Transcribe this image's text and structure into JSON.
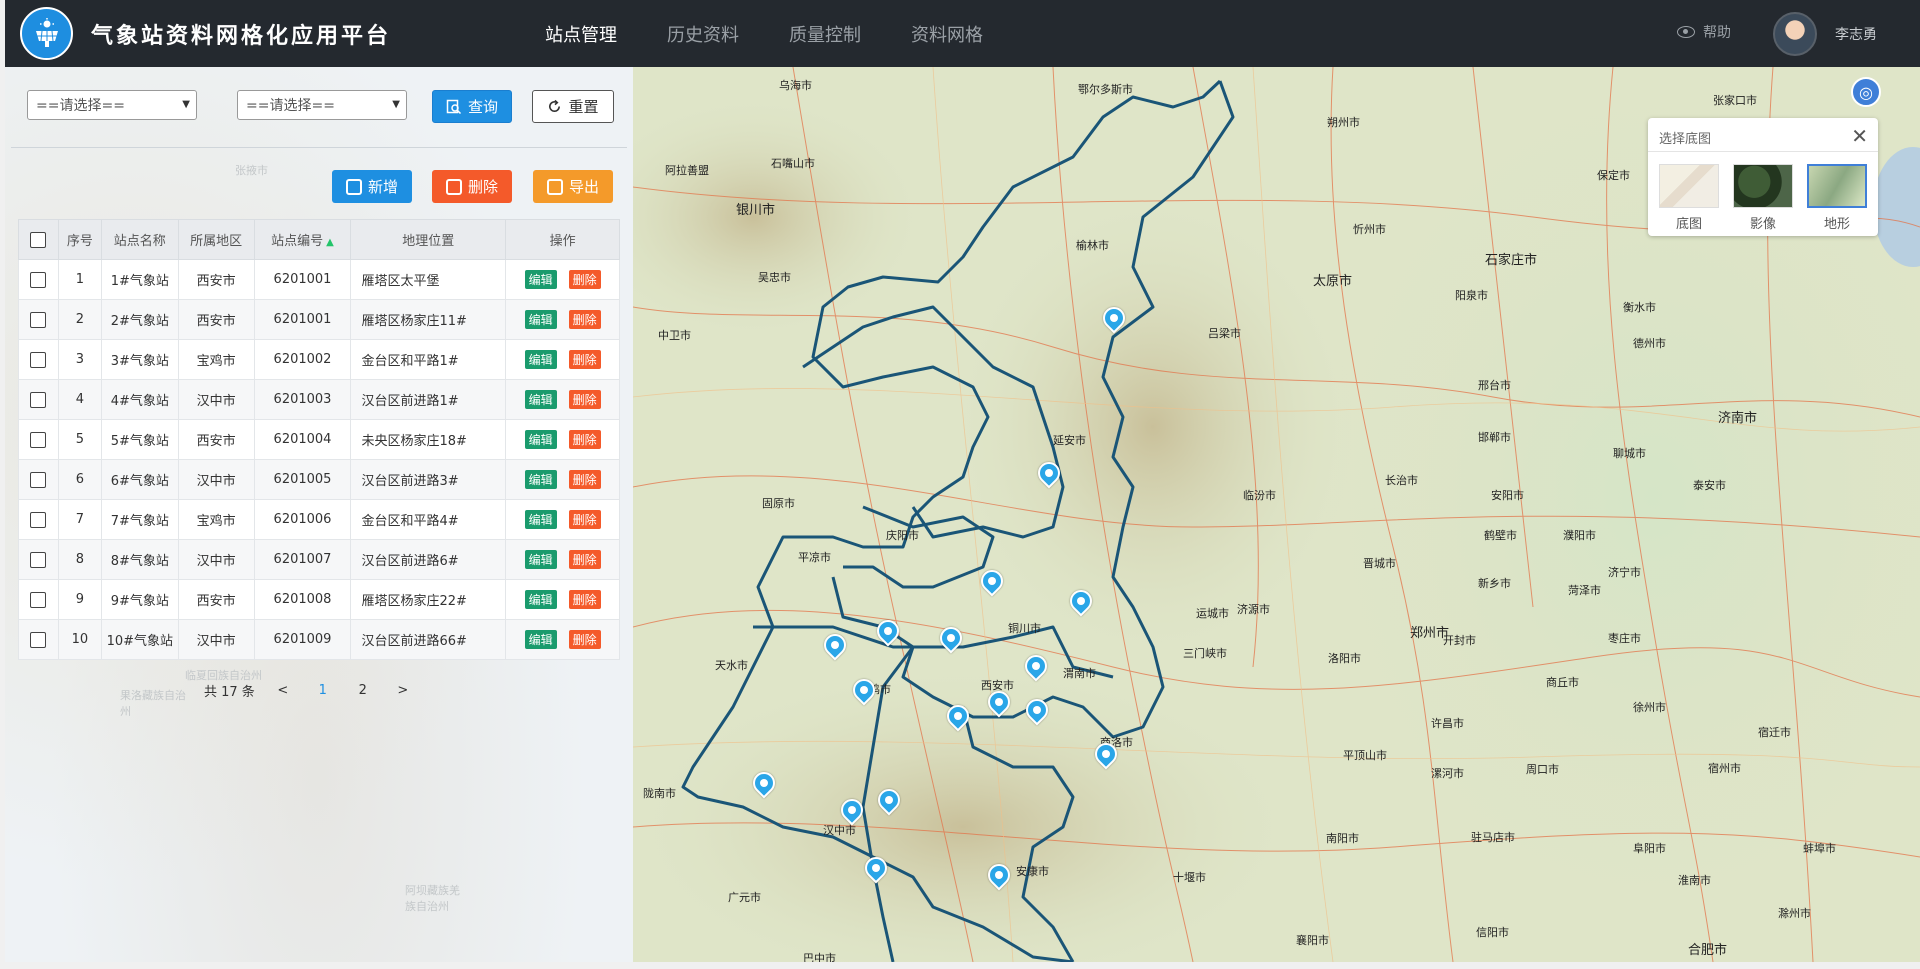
{
  "header": {
    "title": "气象站资料网格化应用平台",
    "nav": [
      "站点管理",
      "历史资料",
      "质量控制",
      "资料网格"
    ],
    "help": "帮助",
    "username": "李志勇"
  },
  "filters": {
    "select1": "==请选择==",
    "select2": "==请选择==",
    "query": "查询",
    "reset": "重置"
  },
  "actions": {
    "add": "新增",
    "delete": "删除",
    "export": "导出"
  },
  "table": {
    "headers": [
      "序号",
      "站点名称",
      "所属地区",
      "站点编号",
      "地理位置",
      "操作"
    ],
    "edit_label": "编辑",
    "delete_label": "删除",
    "rows": [
      {
        "no": "1",
        "name": "1#气象站",
        "region": "西安市",
        "code": "6201001",
        "location": "雁塔区太平堡"
      },
      {
        "no": "2",
        "name": "2#气象站",
        "region": "西安市",
        "code": "6201001",
        "location": "雁塔区杨家庄11#"
      },
      {
        "no": "3",
        "name": "3#气象站",
        "region": "宝鸡市",
        "code": "6201002",
        "location": "金台区和平路1#"
      },
      {
        "no": "4",
        "name": "4#气象站",
        "region": "汉中市",
        "code": "6201003",
        "location": "汉台区前进路1#"
      },
      {
        "no": "5",
        "name": "5#气象站",
        "region": "西安市",
        "code": "6201004",
        "location": "未央区杨家庄18#"
      },
      {
        "no": "6",
        "name": "6#气象站",
        "region": "汉中市",
        "code": "6201005",
        "location": "汉台区前进路3#"
      },
      {
        "no": "7",
        "name": "7#气象站",
        "region": "宝鸡市",
        "code": "6201006",
        "location": "金台区和平路4#"
      },
      {
        "no": "8",
        "name": "8#气象站",
        "region": "汉中市",
        "code": "6201007",
        "location": "汉台区前进路6#"
      },
      {
        "no": "9",
        "name": "9#气象站",
        "region": "西安市",
        "code": "6201008",
        "location": "雁塔区杨家庄22#"
      },
      {
        "no": "10",
        "name": "10#气象站",
        "region": "汉中市",
        "code": "6201009",
        "location": "汉台区前进路66#"
      }
    ]
  },
  "pager": {
    "total": "共 17 条",
    "prev": "<",
    "pages": [
      "1",
      "2"
    ],
    "next": ">"
  },
  "left_bg_labels": [
    "张掖市",
    "临夏回族自治州",
    "果洛藏族自治州",
    "阿坝藏族羌族自治州",
    "广元市",
    "巴中市"
  ],
  "basemap": {
    "title": "选择底图",
    "options": [
      "底图",
      "影像",
      "地形"
    ],
    "selected": "地形"
  },
  "map_labels": [
    "乌海市",
    "鄂尔多斯市",
    "朔州市",
    "张家口市",
    "阿拉善盟",
    "石嘴山市",
    "银川市",
    "保定市",
    "忻州市",
    "榆林市",
    "吴忠市",
    "太原市",
    "阳泉市",
    "石家庄市",
    "中卫市",
    "吕梁市",
    "衡水市",
    "德州市",
    "邢台市",
    "延安市",
    "济南市",
    "邯郸市",
    "聊城市",
    "固原市",
    "庆阳市",
    "临汾市",
    "长治市",
    "安阳市",
    "泰安市",
    "平凉市",
    "鹤壁市",
    "濮阳市",
    "晋城市",
    "新乡市",
    "济宁市",
    "运城市",
    "菏泽市",
    "铜川市",
    "济源市",
    "天水市",
    "三门峡市",
    "郑州市",
    "开封市",
    "枣庄市",
    "宝鸡市",
    "西安市",
    "渭南市",
    "洛阳市",
    "商丘市",
    "徐州市",
    "商洛市",
    "许昌市",
    "平顶山市",
    "宿迁市",
    "陇南市",
    "汉中市",
    "漯河市",
    "周口市",
    "宿州市",
    "南阳市",
    "驻马店市",
    "安康市",
    "十堰市",
    "阜阳市",
    "蚌埠市",
    "淮南市",
    "广元市",
    "襄阳市",
    "信阳市",
    "滁州市",
    "合肥市",
    "巴中市",
    "忻州市"
  ]
}
